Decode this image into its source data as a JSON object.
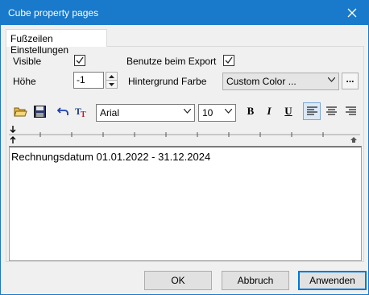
{
  "window": {
    "title": "Cube property pages"
  },
  "tabs": [
    {
      "label": "Fußzeilen Einstellungen"
    }
  ],
  "settings": {
    "visible_label": "Visible",
    "visible_checked": true,
    "export_label": "Benutze beim Export",
    "export_checked": true,
    "height_label": "Höhe",
    "height_value": "-1",
    "background_label": "Hintergrund Farbe",
    "background_value": "Custom Color ...",
    "more_label": "..."
  },
  "toolbar": {
    "font_value": "Arial",
    "size_value": "10",
    "bold_label": "B",
    "italic_label": "I",
    "underline_label": "U"
  },
  "editor": {
    "text": "Rechnungsdatum 01.01.2022 - 31.12.2024"
  },
  "buttons": {
    "ok": "OK",
    "cancel": "Abbruch",
    "apply": "Anwenden"
  },
  "colors": {
    "titlebar": "#1979ca",
    "accent": "#0078d7"
  }
}
